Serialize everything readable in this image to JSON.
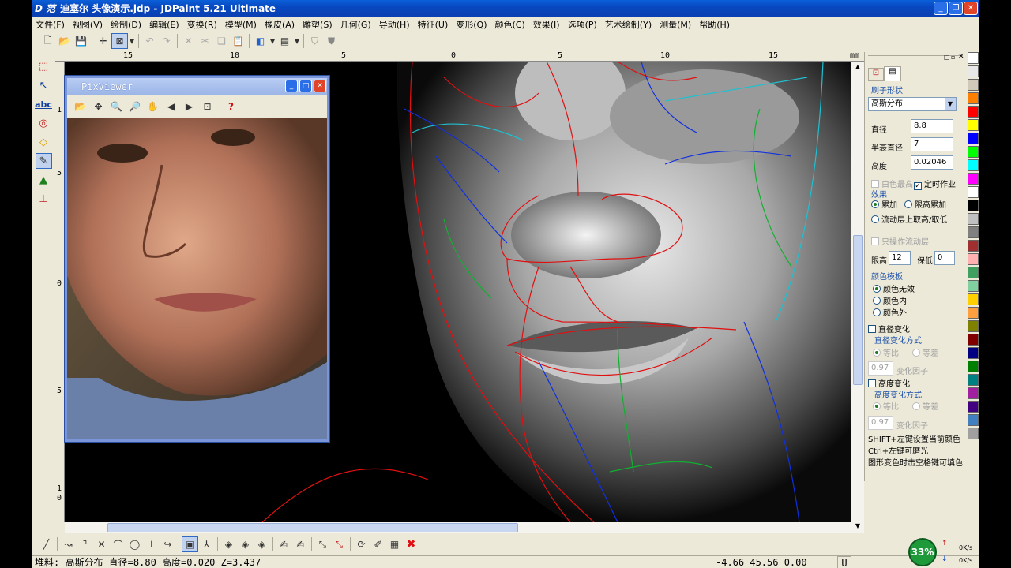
{
  "window": {
    "title": "迪塞尔 头像演示.jdp - JDPaint 5.21 Ultimate",
    "logo": "D 范"
  },
  "menu": [
    "文件(F)",
    "视图(V)",
    "绘制(D)",
    "编辑(E)",
    "变换(R)",
    "模型(M)",
    "橡皮(A)",
    "雕塑(S)",
    "几何(G)",
    "导动(H)",
    "特征(U)",
    "变形(Q)",
    "颜色(C)",
    "效果(I)",
    "选项(P)",
    "艺术绘制(Y)",
    "测量(M)",
    "帮助(H)"
  ],
  "hruler": [
    "15",
    "10",
    "5",
    "0",
    "5",
    "10",
    "15"
  ],
  "hruler_unit": "mm",
  "vruler": [
    "1",
    "5",
    "0",
    "5",
    "1",
    "0"
  ],
  "pixviewer": {
    "title": "PixViewer"
  },
  "panel": {
    "brush_title": "刷子形状",
    "brush_shape": "高斯分布",
    "diameter_label": "直径",
    "diameter": "8.8",
    "half_label": "半衰直径",
    "half": "7",
    "height_label": "高度",
    "height": "0.02046",
    "white_highest": "白色最高",
    "timed": "定时作业",
    "effect_title": "效果",
    "effect_add": "累加",
    "effect_limit": "限高累加",
    "effect_flow": "流动层上取高/取低",
    "only_flow": "只操作流动层",
    "limit_high_label": "限高",
    "limit_high": "12",
    "limit_low_label": "保低",
    "limit_low": "0",
    "color_title": "颜色模板",
    "color_none": "颜色无效",
    "color_in": "颜色内",
    "color_out": "颜色外",
    "dia_change": "直径变化",
    "dia_mode_title": "直径变化方式",
    "equal_ratio": "等比",
    "equal_diff": "等差",
    "factor_value": "0.97",
    "factor_label": "变化因子",
    "height_change": "高度变化",
    "height_mode_title": "高度变化方式",
    "hint1": "SHIFT+左键设置当前颜色",
    "hint2": "Ctrl+左键可磨光",
    "hint3": "图形变色时击空格键可填色"
  },
  "palette": [
    "#ffffff",
    "#e8e8e8",
    "#d0c8b8",
    "#ff8000",
    "#ff0000",
    "#ffff00",
    "#0000ff",
    "#00ff00",
    "#00ffff",
    "#ff00ff",
    "#ffffff",
    "#000000",
    "#c0c0c0",
    "#808080",
    "#a03030",
    "#ffb0b0",
    "#40a060",
    "#80d0a0",
    "#ffd000",
    "#ffa040",
    "#808000",
    "#800000",
    "#000080",
    "#008000",
    "#008080",
    "#a020a0",
    "#400080",
    "#4080c0",
    "#a0a0a0"
  ],
  "status": {
    "text": "堆料: 高斯分布  直径=8.80  高度=0.020  Z=3.437",
    "coords": "-4.66  45.56  0.00",
    "mode": "U"
  },
  "net": {
    "percent": "33%",
    "up": "0K/s",
    "down": "0K/s"
  }
}
